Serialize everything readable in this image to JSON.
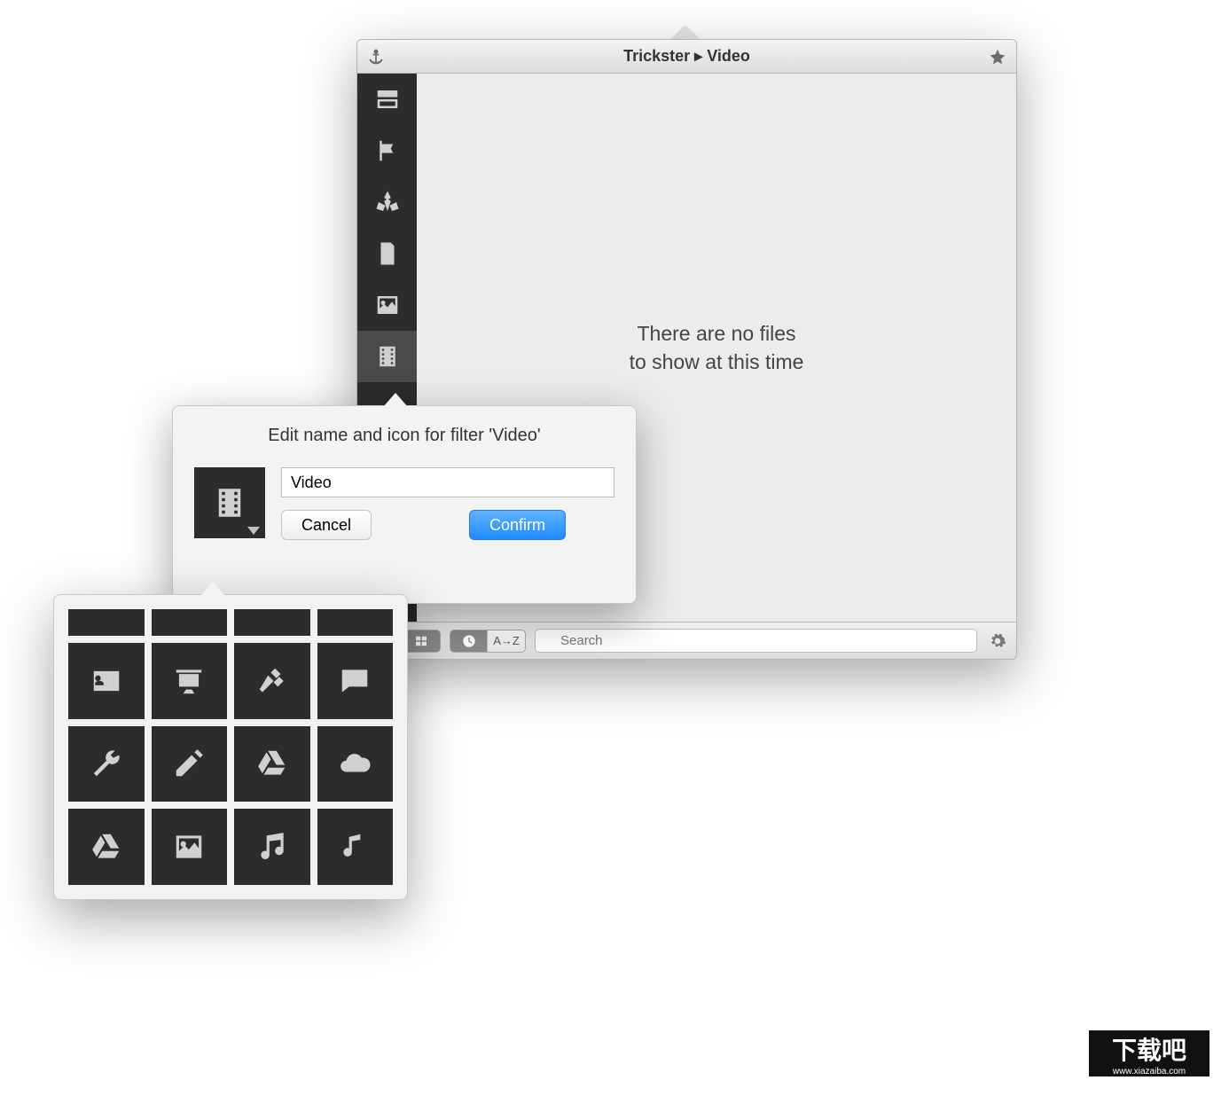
{
  "window": {
    "title": "Trickster ▸ Video"
  },
  "sidebar": {
    "items": [
      {
        "name": "inbox",
        "selected": false
      },
      {
        "name": "flag",
        "selected": false
      },
      {
        "name": "apps",
        "selected": false
      },
      {
        "name": "document",
        "selected": false
      },
      {
        "name": "image",
        "selected": false
      },
      {
        "name": "video",
        "selected": true
      }
    ]
  },
  "content": {
    "empty_line1": "There are no files",
    "empty_line2": "to show at this time"
  },
  "footer": {
    "sort_az": "A→Z",
    "search_placeholder": "Search"
  },
  "edit_popover": {
    "title": "Edit name and icon for filter 'Video'",
    "name_value": "Video",
    "cancel_label": "Cancel",
    "confirm_label": "Confirm"
  },
  "icon_grid": {
    "rows": [
      [
        "blank",
        "blank",
        "blank",
        "blank"
      ],
      [
        "id-card",
        "presentation",
        "gavel",
        "chat"
      ],
      [
        "wrench",
        "pencil",
        "gdrive",
        "cloud"
      ],
      [
        "gdrive-alt",
        "image",
        "music",
        "note"
      ]
    ]
  },
  "watermark": {
    "text": "下载吧",
    "url": "www.xiazaiba.com"
  }
}
